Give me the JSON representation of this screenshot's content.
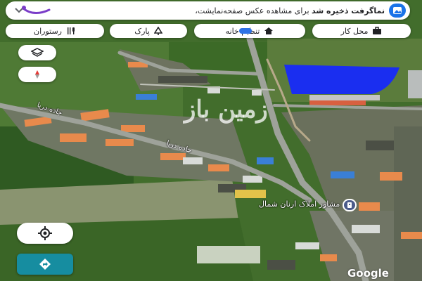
{
  "notification": {
    "bold_text": "نماگرفت ذخیره شد",
    "rest_text": "برای مشاهده عکس صفحه‌نمایشت،",
    "gallery_icon": "gallery-icon",
    "expand_icon": "chevron-down-icon"
  },
  "chips": [
    {
      "label": "محل کار",
      "icon": "briefcase-icon"
    },
    {
      "label": "تنظیم خانه",
      "icon": "home-icon"
    },
    {
      "label": "پارک",
      "icon": "tree-icon"
    },
    {
      "label": "رستوران",
      "icon": "restaurant-icon"
    }
  ],
  "map": {
    "type": "satellite",
    "place_name": "مشاور املاک ارنان شمال",
    "watermark": "زمین باز",
    "road_labels": [
      "جاده دریا",
      "جاده دریا"
    ],
    "attribution": "Google",
    "highlight_color": "#1a2ef0"
  },
  "controls": {
    "layers_icon": "layers-icon",
    "compass_icon": "compass-icon",
    "locate_icon": "my-location-icon",
    "directions_icon": "directions-icon"
  }
}
